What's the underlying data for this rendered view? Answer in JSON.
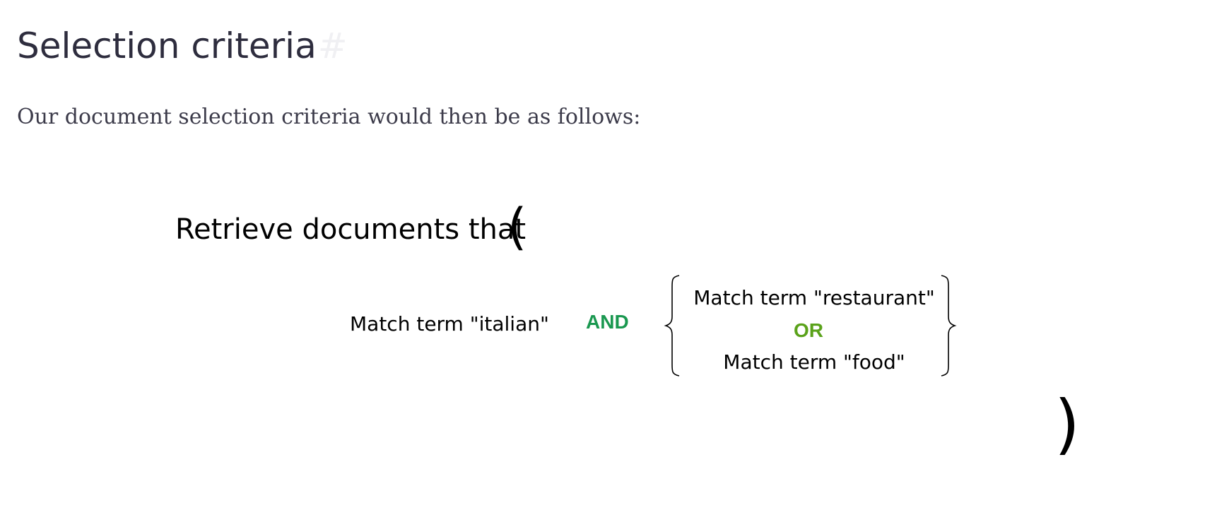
{
  "heading": {
    "title": "Selection criteria",
    "anchor": "#"
  },
  "intro": "Our document selection criteria would then be as follows:",
  "diagram": {
    "lead_text": "Retrieve documents that",
    "open_paren": "(",
    "close_paren": ")",
    "term_left": "Match term \"italian\"",
    "and_label": "AND",
    "term_top": "Match term \"restaurant\"",
    "or_label": "OR",
    "term_bottom": "Match term \"food\"",
    "colors": {
      "and": "#1a9850",
      "or": "#5aa21a",
      "text": "#000000"
    }
  }
}
